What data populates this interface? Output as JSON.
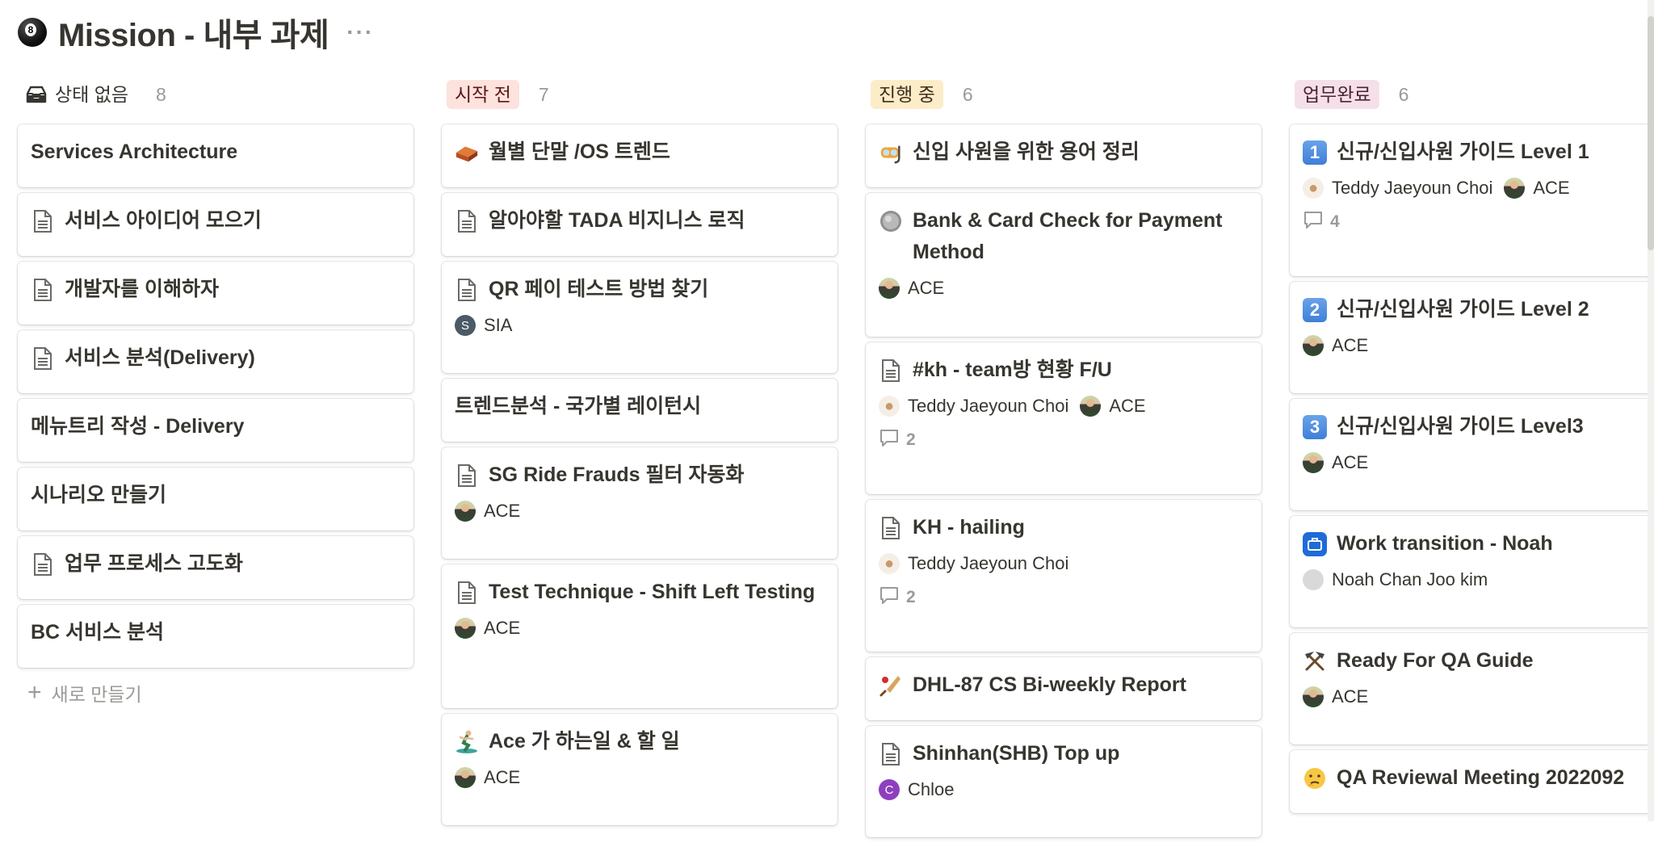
{
  "page": {
    "title": "Mission - 내부 과제",
    "more": "···"
  },
  "columns": [
    {
      "name": "상태 없음",
      "count": "8",
      "color": "transparent",
      "cards": [
        {
          "title": "Services Architecture",
          "icon": ""
        },
        {
          "title": "서비스 아이디어 모으기",
          "icon": "page-icon"
        },
        {
          "title": "개발자를 이해하자",
          "icon": "page-icon"
        },
        {
          "title": "서비스 분석(Delivery)",
          "icon": "page-icon"
        },
        {
          "title": "메뉴트리 작성 - Delivery",
          "icon": ""
        },
        {
          "title": "시나리오 만들기",
          "icon": ""
        },
        {
          "title": "업무 프로세스 고도화",
          "icon": "page-icon"
        },
        {
          "title": "BC 서비스 분석",
          "icon": ""
        }
      ],
      "new_label": "새로 만들기"
    },
    {
      "name": "시작 전",
      "count": "7",
      "color": "#fde2dd",
      "cards": [
        {
          "title": "월별 단말 /OS 트렌드",
          "icon": "brick-icon"
        },
        {
          "title": "알아야할 TADA 비지니스 로직",
          "icon": "page-icon"
        },
        {
          "title": "QR 페이 테스트 방법 찾기",
          "icon": "page-icon",
          "people": [
            "SIA"
          ]
        },
        {
          "title": "트렌드분석 - 국가별 레이턴시",
          "icon": ""
        },
        {
          "title": "SG Ride Frauds 필터 자동화",
          "icon": "page-icon",
          "people": [
            "ACE"
          ]
        },
        {
          "title": "Test Technique - Shift Left Testing",
          "icon": "page-icon",
          "people": [
            "ACE"
          ]
        },
        {
          "title": "Ace 가 하는일 & 할 일",
          "icon": "surfer-icon",
          "people": [
            "ACE"
          ]
        }
      ]
    },
    {
      "name": "진행 중",
      "count": "6",
      "color": "#fdecc8",
      "cards": [
        {
          "title": "신입 사원을 위한 용어 정리",
          "icon": "diving-mask-icon"
        },
        {
          "title": "Bank & Card Check for Payment Method",
          "icon": "coin-icon",
          "people": [
            "ACE"
          ]
        },
        {
          "title": "#kh - team방 현황 F/U",
          "icon": "page-icon",
          "people": [
            "Teddy Jaeyoun Choi",
            "ACE"
          ],
          "comments": "2"
        },
        {
          "title": "KH - hailing",
          "icon": "page-icon",
          "people": [
            "Teddy Jaeyoun Choi"
          ],
          "comments": "2"
        },
        {
          "title": "DHL-87 CS Bi-weekly Report",
          "icon": "cricket-icon"
        },
        {
          "title": "Shinhan(SHB) Top up",
          "icon": "page-icon",
          "people": [
            "Chloe"
          ]
        }
      ]
    },
    {
      "name": "업무완료",
      "count": "6",
      "color": "#f5e0e9",
      "cards": [
        {
          "title": "신규/신입사원 가이드 Level 1",
          "icon": "keycap-1-icon",
          "badge": "1",
          "people": [
            "Teddy Jaeyoun Choi",
            "ACE"
          ],
          "comments": "4"
        },
        {
          "title": "신규/신입사원 가이드 Level 2",
          "icon": "keycap-2-icon",
          "badge": "2",
          "people": [
            "ACE"
          ]
        },
        {
          "title": "신규/신입사원 가이드 Level3",
          "icon": "keycap-3-icon",
          "badge": "3",
          "people": [
            "ACE"
          ]
        },
        {
          "title": "Work transition - Noah",
          "icon": "briefcase-icon",
          "people": [
            "Noah Chan Joo kim"
          ]
        },
        {
          "title": "Ready For QA Guide",
          "icon": "hammer-pick-icon",
          "people": [
            "ACE"
          ]
        },
        {
          "title": "QA Reviewal Meeting 2022092",
          "icon": "thinking-face-icon"
        }
      ]
    }
  ],
  "avatars": {
    "SIA": "S",
    "Chloe": "C"
  }
}
